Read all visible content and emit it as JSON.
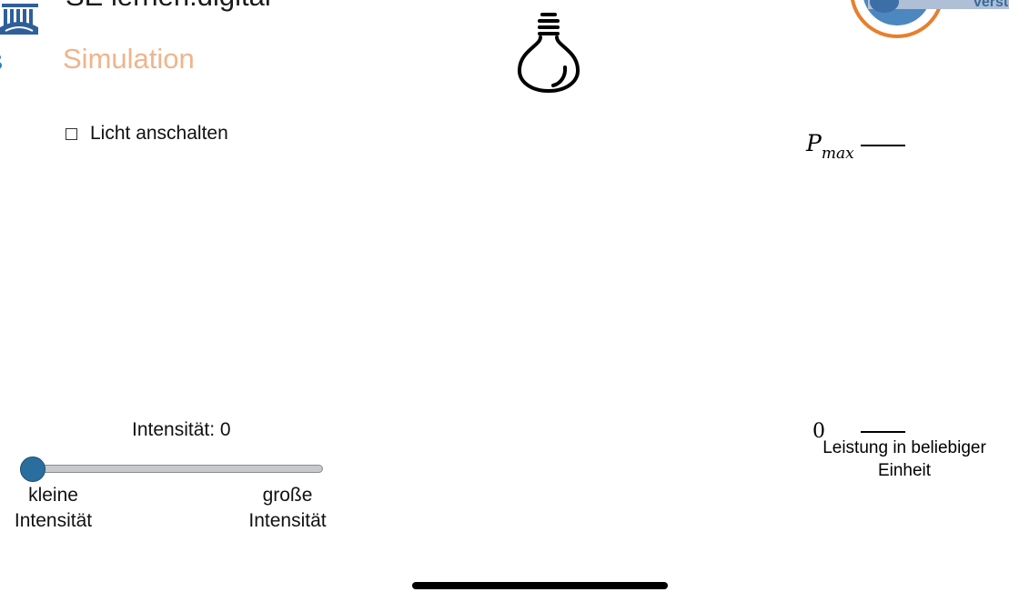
{
  "header": {
    "site_title": "SE lernen.digital",
    "section_title": "Simulation"
  },
  "icons": {
    "left_logo": "university-logo-icon",
    "right_logo": "circular-partner-logo-icon",
    "bulb": "light-bulb-icon"
  },
  "controls": {
    "light_toggle": {
      "label": "Licht anschalten",
      "checked": false
    },
    "intensity": {
      "readout": "Intensität: 0",
      "value": 0,
      "min_label": "kleine Intensität",
      "max_label": "große Intensität"
    }
  },
  "meter": {
    "max_symbol": "P",
    "max_subscript": "max",
    "zero_label": "0",
    "caption": "Leistung in beliebiger Einheit",
    "level": 0
  },
  "colors": {
    "section_title": "#efb48c",
    "slider_thumb": "#2a6e9e",
    "slider_track": "#c7c9cc",
    "logo_blue": "#2f6fa6",
    "logo_orange": "#e87f2c"
  }
}
